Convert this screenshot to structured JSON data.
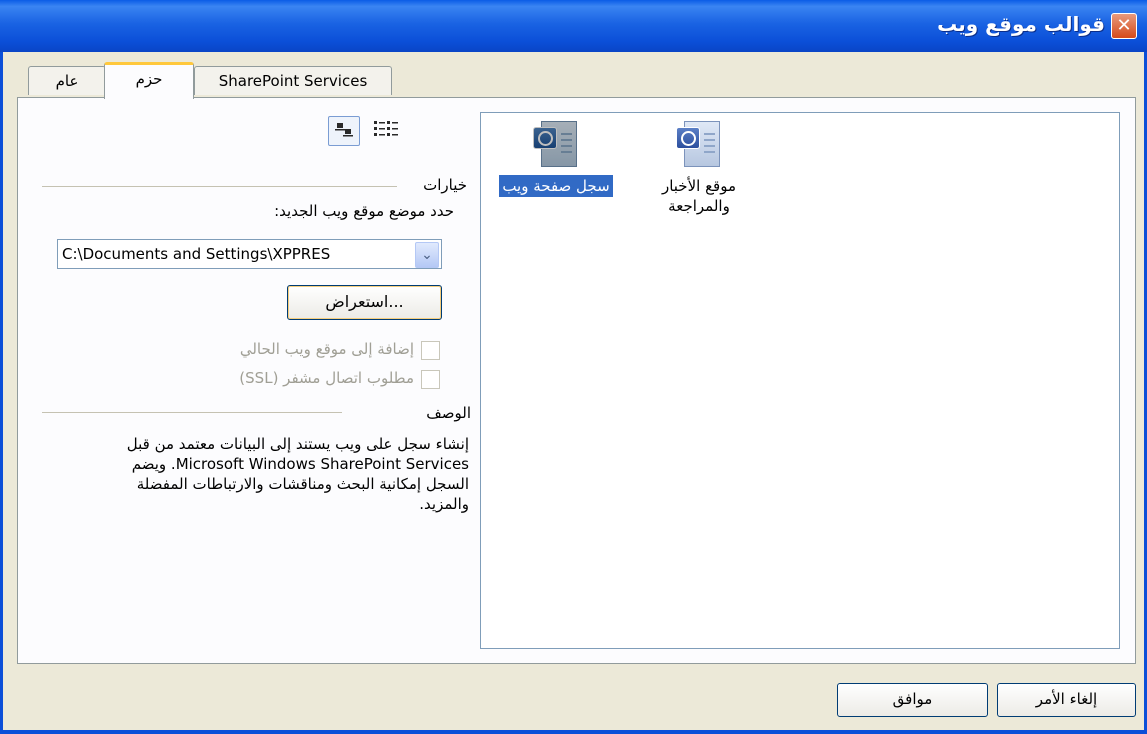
{
  "window": {
    "title": "قوالب موقع ويب",
    "close_glyph": "✕"
  },
  "tabs": [
    {
      "label": "عام"
    },
    {
      "label": "حزم"
    },
    {
      "label": "SharePoint Services"
    }
  ],
  "view_icons": {
    "large": "large-icons-view-icon",
    "list": "list-view-icon"
  },
  "options": {
    "heading": "خيارات",
    "location_label": "حدد موضع موقع ويب الجديد:",
    "location_value": "C:\\Documents and Settings\\XPPRES",
    "browse_label": "استعراض...",
    "add_to_current_label": "إضافة إلى موقع ويب الحالي",
    "ssl_label": "مطلوب اتصال مشفر (SSL)"
  },
  "description": {
    "heading": "الوصف",
    "text": "إنشاء سجل على ويب يستند إلى البيانات معتمد من قبل Microsoft Windows SharePoint Services. ويضم السجل إمكانية البحث ومناقشات والارتباطات المفضلة والمزيد."
  },
  "templates": [
    {
      "label": "سجل صفحة ويب",
      "selected": true
    },
    {
      "label": "موقع الأخبار والمراجعة",
      "selected": false
    }
  ],
  "buttons": {
    "ok": "موافق",
    "cancel": "إلغاء الأمر"
  }
}
